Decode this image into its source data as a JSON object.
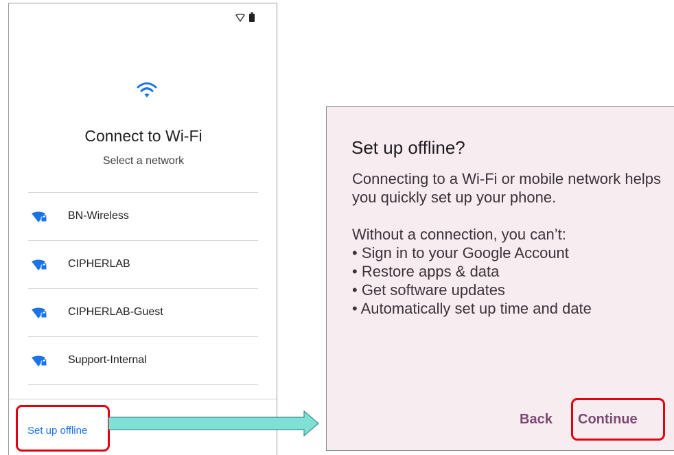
{
  "setup_screen": {
    "title": "Connect to Wi-Fi",
    "subtitle": "Select a network",
    "networks": [
      {
        "label": "BN-Wireless"
      },
      {
        "label": "CIPHERLAB"
      },
      {
        "label": "CIPHERLAB-Guest"
      },
      {
        "label": "Support-Internal"
      }
    ],
    "offline_link": "Set up offline"
  },
  "dialog": {
    "title": "Set up offline?",
    "body": "Connecting to a Wi-Fi or mobile network helps you quickly set up your phone.",
    "list_intro": "Without a connection, you can’t:",
    "items": [
      "• Sign in to your Google Account",
      "• Restore apps & data",
      "• Get software updates",
      "• Automatically set up time and date"
    ],
    "back_label": "Back",
    "continue_label": "Continue"
  },
  "colors": {
    "accent": "#1a73e8",
    "highlight": "#e3000f",
    "dialog_bg": "#f7ecf0",
    "dialog_button": "#7b4a73",
    "arrow": "#7fe0d6"
  },
  "icons": {
    "status": [
      "wifi-outline-icon",
      "battery-icon"
    ],
    "hero": "wifi-icon",
    "network": "wifi-lock-icon"
  }
}
